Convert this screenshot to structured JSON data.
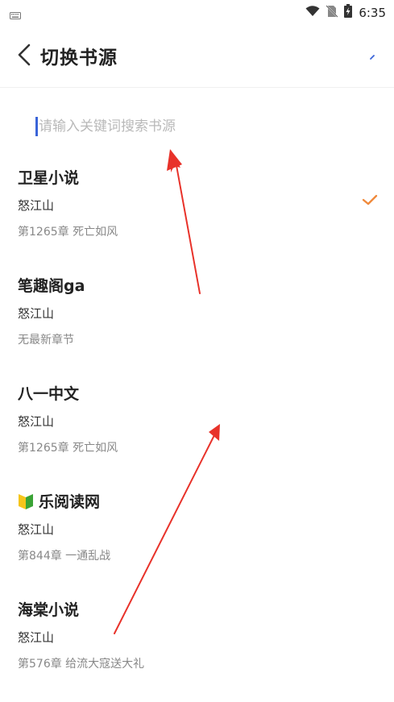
{
  "status_bar": {
    "time": "6:35",
    "icons": [
      "keyboard-icon",
      "wifi-icon",
      "no-sim-icon",
      "battery-charging-icon"
    ]
  },
  "header": {
    "title": "切换书源",
    "back_icon": "chevron-left-icon",
    "confirm_icon": "check-icon"
  },
  "search": {
    "placeholder": "请输入关键词搜索书源",
    "value": ""
  },
  "sources": [
    {
      "name": "卫星小说",
      "author": "怒江山",
      "chapter": "第1265章 死亡如风",
      "selected": true,
      "badge": ""
    },
    {
      "name": "笔趣阁ga",
      "author": "怒江山",
      "chapter": "无最新章节",
      "selected": false,
      "badge": ""
    },
    {
      "name": "八一中文",
      "author": "怒江山",
      "chapter": "第1265章 死亡如风",
      "selected": false,
      "badge": ""
    },
    {
      "name": "乐阅读网",
      "author": "怒江山",
      "chapter": "第844章 一通乱战",
      "selected": false,
      "badge": "beginner-badge-icon"
    },
    {
      "name": "海棠小说",
      "author": "怒江山",
      "chapter": "第576章 给流大寇送大礼",
      "selected": false,
      "badge": ""
    }
  ],
  "colors": {
    "check": "#f08a3c",
    "caret": "#3a64d8",
    "annotation_arrow": "#e8322a",
    "confirm": "#3a64d8"
  }
}
